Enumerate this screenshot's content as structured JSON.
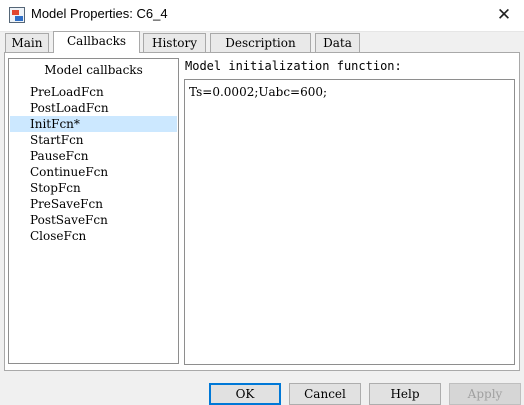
{
  "window": {
    "title": "Model Properties: C6_4",
    "close_symbol": "✕"
  },
  "tabs": [
    {
      "label": "Main",
      "active": false
    },
    {
      "label": "Callbacks",
      "active": true
    },
    {
      "label": "History",
      "active": false
    },
    {
      "label": "Description",
      "active": false
    },
    {
      "label": "Data",
      "active": false
    }
  ],
  "callbacks": {
    "list_header": "Model callbacks",
    "items": [
      {
        "label": "PreLoadFcn"
      },
      {
        "label": "PostLoadFcn"
      },
      {
        "label": "InitFcn*",
        "selected": true
      },
      {
        "label": "StartFcn"
      },
      {
        "label": "PauseFcn"
      },
      {
        "label": "ContinueFcn"
      },
      {
        "label": "StopFcn"
      },
      {
        "label": "PreSaveFcn"
      },
      {
        "label": "PostSaveFcn"
      },
      {
        "label": "CloseFcn"
      }
    ],
    "function_label": "Model initialization function:",
    "function_code": "Ts=0.0002;Uabc=600;"
  },
  "buttons": {
    "ok": "OK",
    "cancel": "Cancel",
    "help": "Help",
    "apply": "Apply"
  },
  "colors": {
    "selection": "#cce8ff",
    "default_button_border": "#0078d7"
  }
}
